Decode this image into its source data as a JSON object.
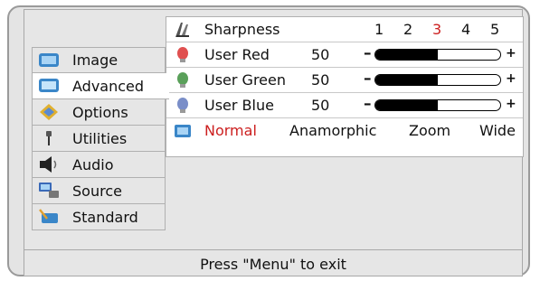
{
  "sidebar": {
    "items": [
      {
        "label": "Image",
        "icon": "monitor-icon"
      },
      {
        "label": "Advanced",
        "icon": "monitor-advanced-icon",
        "active": true
      },
      {
        "label": "Options",
        "icon": "options-diamond-icon"
      },
      {
        "label": "Utilities",
        "icon": "utilities-tool-icon"
      },
      {
        "label": "Audio",
        "icon": "speaker-icon"
      },
      {
        "label": "Source",
        "icon": "source-computer-icon"
      },
      {
        "label": "Standard",
        "icon": "standard-pen-icon"
      }
    ]
  },
  "panel": {
    "sharpness": {
      "label": "Sharpness",
      "options": [
        "1",
        "2",
        "3",
        "4",
        "5"
      ],
      "selected": "3"
    },
    "user_red": {
      "label": "User Red",
      "value": "50",
      "level": 0.5
    },
    "user_green": {
      "label": "User Green",
      "value": "50",
      "level": 0.5
    },
    "user_blue": {
      "label": "User Blue",
      "value": "50",
      "level": 0.5
    },
    "minus_symbol": "–",
    "plus_symbol": "+",
    "aspect": {
      "options": [
        "Normal",
        "Anamorphic",
        "Zoom",
        "Wide"
      ],
      "selected": "Normal"
    }
  },
  "footer": {
    "text": "Press \"Menu\" to exit"
  },
  "colors": {
    "selected": "#cc1f1f",
    "frame": "#e4e4e4",
    "panel": "#ffffff"
  }
}
